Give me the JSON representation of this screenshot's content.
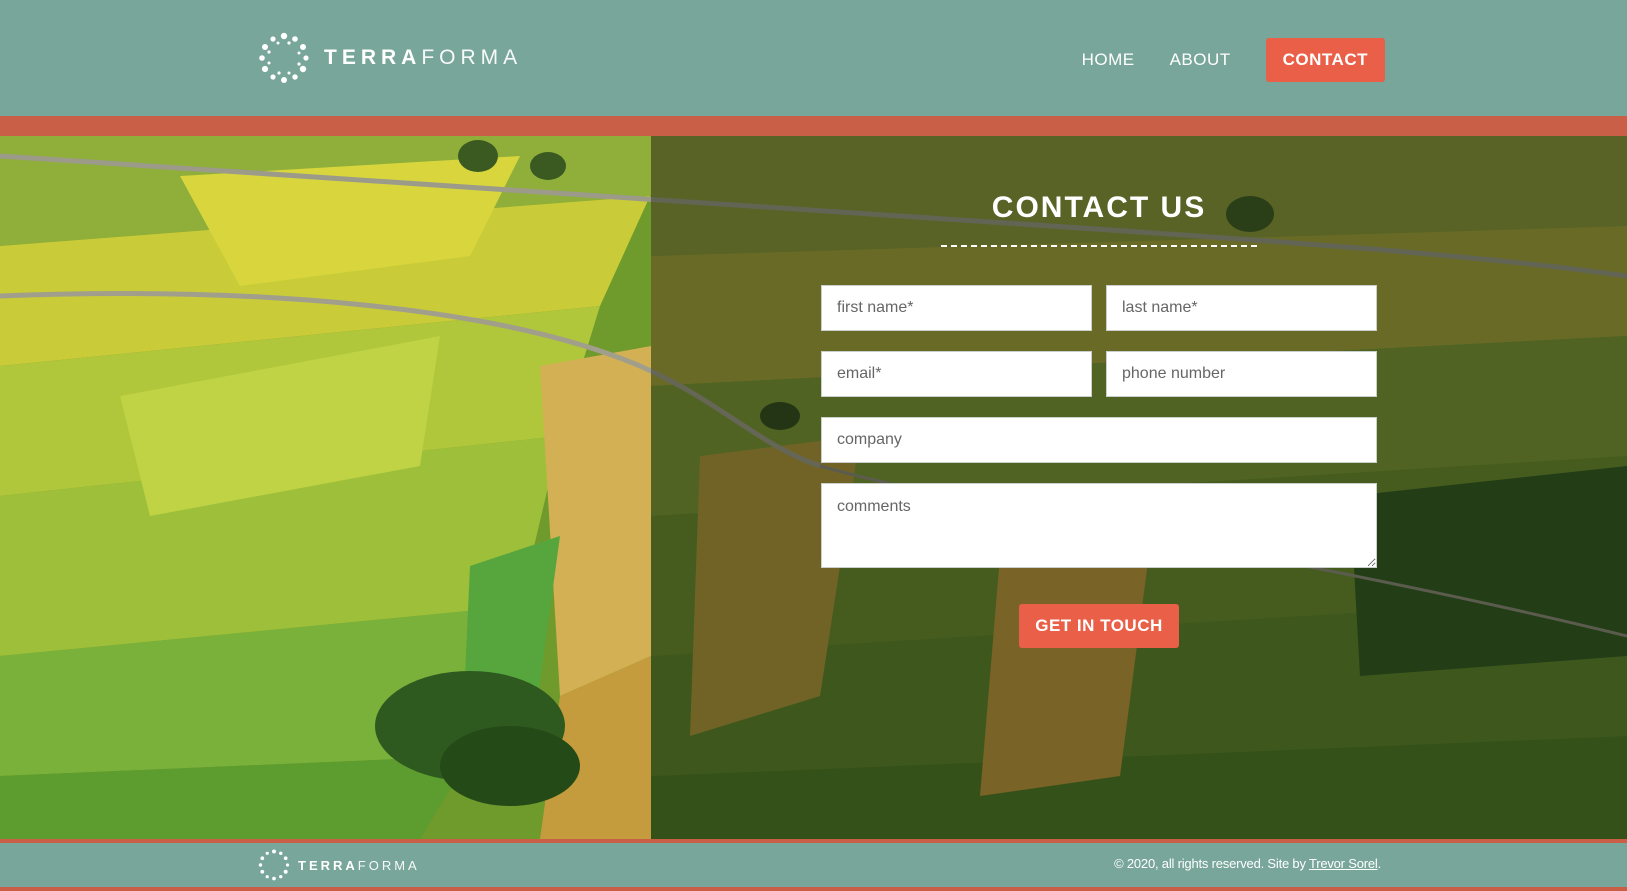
{
  "header": {
    "logo": {
      "icon": "dotted-ring-logo",
      "brand_bold": "TERRA",
      "brand_light": "FORMA"
    },
    "nav": {
      "home": "HOME",
      "about": "ABOUT",
      "contact": "CONTACT"
    }
  },
  "hero": {
    "background": "aerial-farmland-photo"
  },
  "form": {
    "title": "CONTACT US",
    "first_name_placeholder": "first name*",
    "last_name_placeholder": "last name*",
    "email_placeholder": "email*",
    "phone_placeholder": "phone number",
    "company_placeholder": "company",
    "comments_placeholder": "comments",
    "submit_label": "GET IN TOUCH"
  },
  "footer": {
    "logo": {
      "brand_bold": "TERRA",
      "brand_light": "FORMA"
    },
    "copyright_prefix": "© 2020, all rights reserved. Site by ",
    "credit_link": "Trevor Sorel",
    "copyright_suffix": "."
  },
  "colors": {
    "header_bg": "#78a69a",
    "accent": "#ea5f47",
    "accent_bar": "#ca5f48"
  }
}
